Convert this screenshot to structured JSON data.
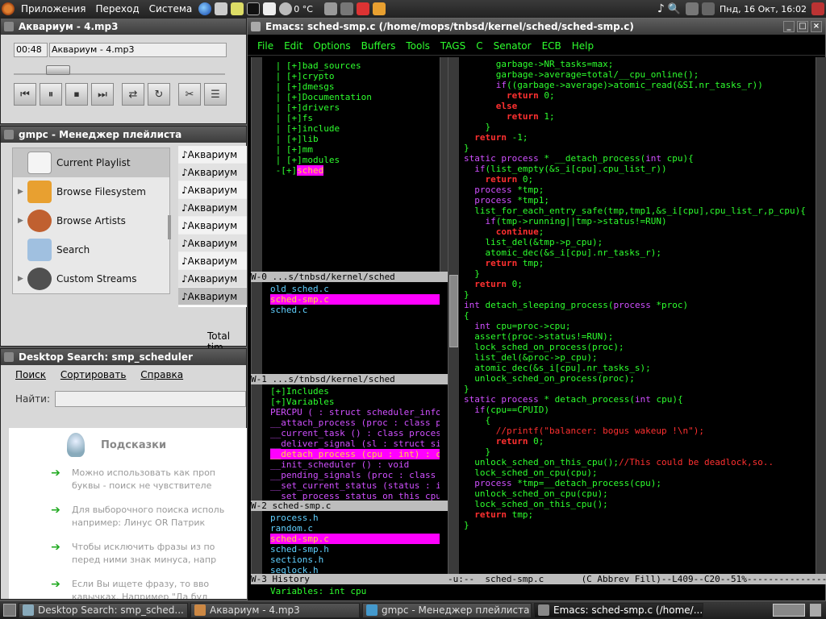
{
  "top_panel": {
    "menus": [
      "Приложения",
      "Переход",
      "Система"
    ],
    "temperature": "0 °C",
    "clock": "Пнд, 16 Окт, 16:02"
  },
  "player": {
    "title": "Аквариум - 4.mp3",
    "time": "00:48",
    "track": "Аквариум - 4.mp3"
  },
  "gmpc": {
    "title": "gmpc - Менеджер плейлиста",
    "sidebar": [
      {
        "label": "Current Playlist",
        "icon": "playlist-icon",
        "color": "#eeeeee"
      },
      {
        "label": "Browse Filesystem",
        "icon": "folder-icon",
        "color": "#e8a030"
      },
      {
        "label": "Browse Artists",
        "icon": "artist-icon",
        "color": "#c06030"
      },
      {
        "label": "Search",
        "icon": "search-icon",
        "color": "#a0c0e0"
      },
      {
        "label": "Custom Streams",
        "icon": "speaker-icon",
        "color": "#505050"
      }
    ],
    "playlist": [
      "Аквариум",
      "Аквариум",
      "Аквариум",
      "Аквариум",
      "Аквариум",
      "Аквариум",
      "Аквариум",
      "Аквариум",
      "Аквариум"
    ],
    "total_label": "Total tim"
  },
  "desktop_search": {
    "title": "Desktop Search: smp_scheduler",
    "menu": [
      "Поиск",
      "Сортировать",
      "Справка"
    ],
    "find_label": "Найти:",
    "hints_title": "Подсказки",
    "hints": [
      [
        "Можно использовать как проп",
        "буквы - поиск не чувствителе"
      ],
      [
        "Для выборочного поиска исполь",
        "например: Линус OR Патрик"
      ],
      [
        "Чтобы исключить фразы из по",
        "перед ними знак минуса, напр"
      ],
      [
        "Если Вы ищете фразу, то вво",
        "кавычках. Например \"Да буд"
      ]
    ]
  },
  "emacs": {
    "title": "Emacs: sched-smp.c (/home/mops/tnbsd/kernel/sched/sched-smp.c)",
    "menu": [
      "File",
      "Edit",
      "Options",
      "Buffers",
      "Tools",
      "TAGS",
      "C",
      "Senator",
      "ECB",
      "Help"
    ],
    "dir_tree": [
      " | [+]bad_sources",
      " | [+]crypto",
      " | [+]dmesgs",
      " | [+]Documentation",
      " | [+]drivers",
      " | [+]fs",
      " | [+]include",
      " | [+]lib",
      " | [+]mm",
      " | [+]modules",
      " -[+]sched"
    ],
    "w0_mode": "W-0 ...s/tnbsd/kernel/sched",
    "w0_files": [
      "old_sched.c",
      "sched-smp.c",
      "sched.c"
    ],
    "w1_mode": "W-1 ...s/tnbsd/kernel/sched",
    "w1_items": [
      "[+]Includes",
      "[+]Variables",
      "PERCPU ( : struct scheduler_info, ",
      "__attach_process (proc : class pro",
      "__current_task () : class process*",
      "__deliver_signal (sl : struct sig_",
      "__detach_process (cpu : int) : cla",
      "__init_scheduler () : void",
      "__pending_signals (proc : class pr",
      "__set_current_status (status : int",
      "__set_process_status_on_this_cpu ("
    ],
    "w2_mode": "W-2 sched-smp.c",
    "w2_files": [
      "process.h",
      "random.c",
      "sched-smp.c",
      "sched-smp.h",
      "sections.h",
      "seqlock.h"
    ],
    "w3_mode": "W-3 History",
    "status_line": "-u:--  sched-smp.c       (C Abbrev Fill)--L409--C20--51%---------------------",
    "minibuffer": "Variables: int cpu",
    "code": [
      "      garbage->NR_tasks=max;",
      "      garbage->average=total/__cpu_online();",
      "      if((garbage->average)>atomic_read(&SI.nr_tasks_r))",
      "        return 0;",
      "      else",
      "        return 1;",
      "    }",
      "  return -1;",
      "}",
      "",
      "static process * __detach_process(int cpu){",
      "  if(list_empty(&s_i[cpu].cpu_list_r))",
      "    return 0;",
      "  process *tmp;",
      "  process *tmp1;",
      "  list_for_each_entry_safe(tmp,tmp1,&s_i[cpu],cpu_list_r,p_cpu){",
      "    if(tmp->running||tmp->status!=RUN)",
      "      continue;",
      "    list_del(&tmp->p_cpu);",
      "    atomic_dec(&s_i[cpu].nr_tasks_r);",
      "    return tmp;",
      "  }",
      "  return 0;",
      "}",
      "",
      "int detach_sleeping_process(process *proc)",
      "{",
      "  int cpu=proc->cpu;",
      "  assert(proc->status!=RUN);",
      "  lock_sched_on_process(proc);",
      "  list_del(&proc->p_cpu);",
      "  atomic_dec(&s_i[cpu].nr_tasks_s);",
      "  unlock_sched_on_process(proc);",
      "}",
      "",
      "static process * detach_process(int cpu){",
      "  if(cpu==CPUID)",
      "    {",
      "      //printf(\"balancer: bogus wakeup !\\n\");",
      "      return 0;",
      "    }",
      "  unlock_sched_on_this_cpu();//This could be deadlock,so..",
      "  lock_sched_on_cpu(cpu);",
      "  process *tmp=__detach_process(cpu);",
      "  unlock_sched_on_cpu(cpu);",
      "  lock_sched_on_this_cpu();",
      "  return tmp;",
      "}"
    ]
  },
  "taskbar": [
    {
      "label": "Desktop Search: smp_sched...",
      "color": "#8ab"
    },
    {
      "label": "Аквариум - 4.mp3",
      "color": "#c84"
    },
    {
      "label": "gmpc - Менеджер плейлиста",
      "color": "#49c"
    },
    {
      "label": "Emacs: sched-smp.c (/home/...",
      "color": "#888"
    }
  ]
}
